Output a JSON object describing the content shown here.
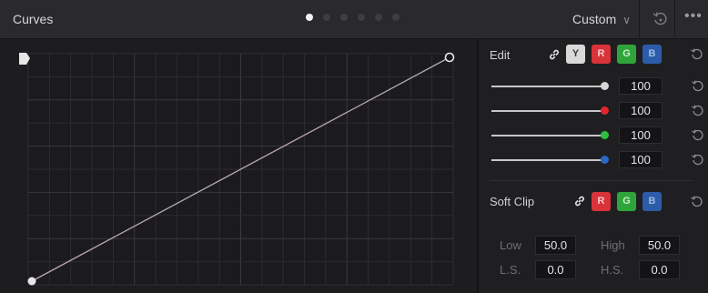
{
  "header": {
    "title": "Curves",
    "page_dots": {
      "count": 6,
      "active_index": 0
    },
    "preset_label": "Custom",
    "preset_chevron": "chevron-down-icon",
    "reset_icon": "reset-icon",
    "more_label": "•••"
  },
  "curve": {
    "start_point": {
      "input": 0,
      "output": 0
    },
    "end_point": {
      "input": 1,
      "output": 1
    },
    "line_color": "#b9a9ad",
    "grid_color": "#2c2c31",
    "major_grid_color": "#38383e"
  },
  "edit": {
    "label": "Edit",
    "link_icon": "link-icon",
    "channels": [
      "Y",
      "R",
      "G",
      "B"
    ],
    "selected_channel": "Y",
    "reset_icon": "reset-icon",
    "sliders": [
      {
        "channel": "Y",
        "value": "100",
        "color": "#d6d6d6"
      },
      {
        "channel": "R",
        "value": "100",
        "color": "#e1262d"
      },
      {
        "channel": "G",
        "value": "100",
        "color": "#2fbf3f"
      },
      {
        "channel": "B",
        "value": "100",
        "color": "#2d66c4"
      }
    ]
  },
  "soft_clip": {
    "label": "Soft Clip",
    "link_icon": "link-icon",
    "channels": [
      "R",
      "G",
      "B"
    ],
    "low_label": "Low",
    "low_value": "50.0",
    "high_label": "High",
    "high_value": "50.0",
    "ls_label": "L.S.",
    "ls_value": "0.0",
    "hs_label": "H.S.",
    "hs_value": "0.0"
  }
}
